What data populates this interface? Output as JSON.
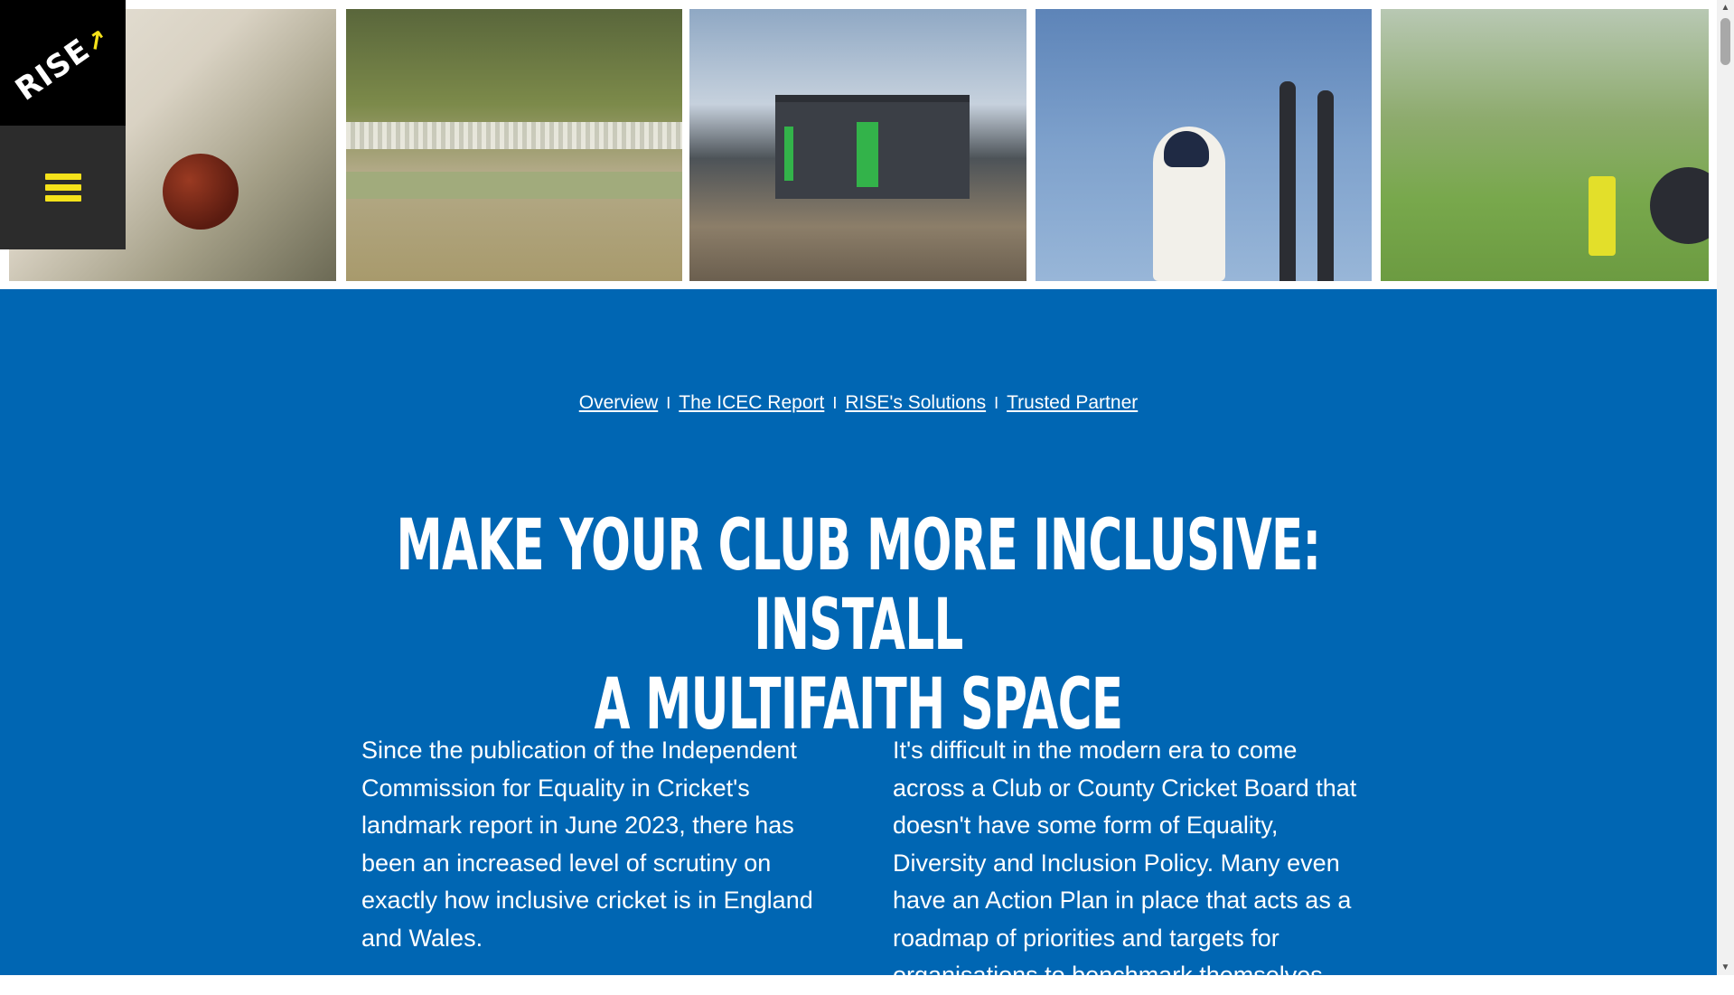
{
  "brand": {
    "logo_text": "RISE",
    "accent_color": "#f5e21a"
  },
  "menu": {
    "icon": "hamburger-menu-icon"
  },
  "hero": {
    "photos": [
      {
        "alt": "batting glove and cricket ball"
      },
      {
        "alt": "batsman and wicketkeeper on club pitch"
      },
      {
        "alt": "dark modular building with green doors"
      },
      {
        "alt": "batsman raising bat near stumps"
      },
      {
        "alt": "cricketer seated on grass with bat and bottle"
      }
    ]
  },
  "subnav": {
    "items": [
      "Overview",
      "The ICEC Report",
      "RISE's Solutions",
      "Trusted Partner"
    ],
    "separator": "I"
  },
  "headline": {
    "line1": "Make your club more inclusive: Install",
    "line2": "a multifaith space"
  },
  "body": {
    "left": "Since the publication of the Independent Commission for Equality in Cricket's landmark report in June 2023, there has been an increased level of scrutiny on exactly how inclusive cricket is in England and Wales.",
    "right": "It's difficult in the modern era to come across a Club or County Cricket Board that doesn't have some form of Equality, Diversity and Inclusion Policy. Many even have an Action Plan in place that acts as a roadmap of priorities and targets for organisations to benchmark themselves"
  },
  "colors": {
    "background_blue": "#0066b3",
    "menu_bg": "#2c2c2c",
    "logo_bg": "#000000"
  }
}
